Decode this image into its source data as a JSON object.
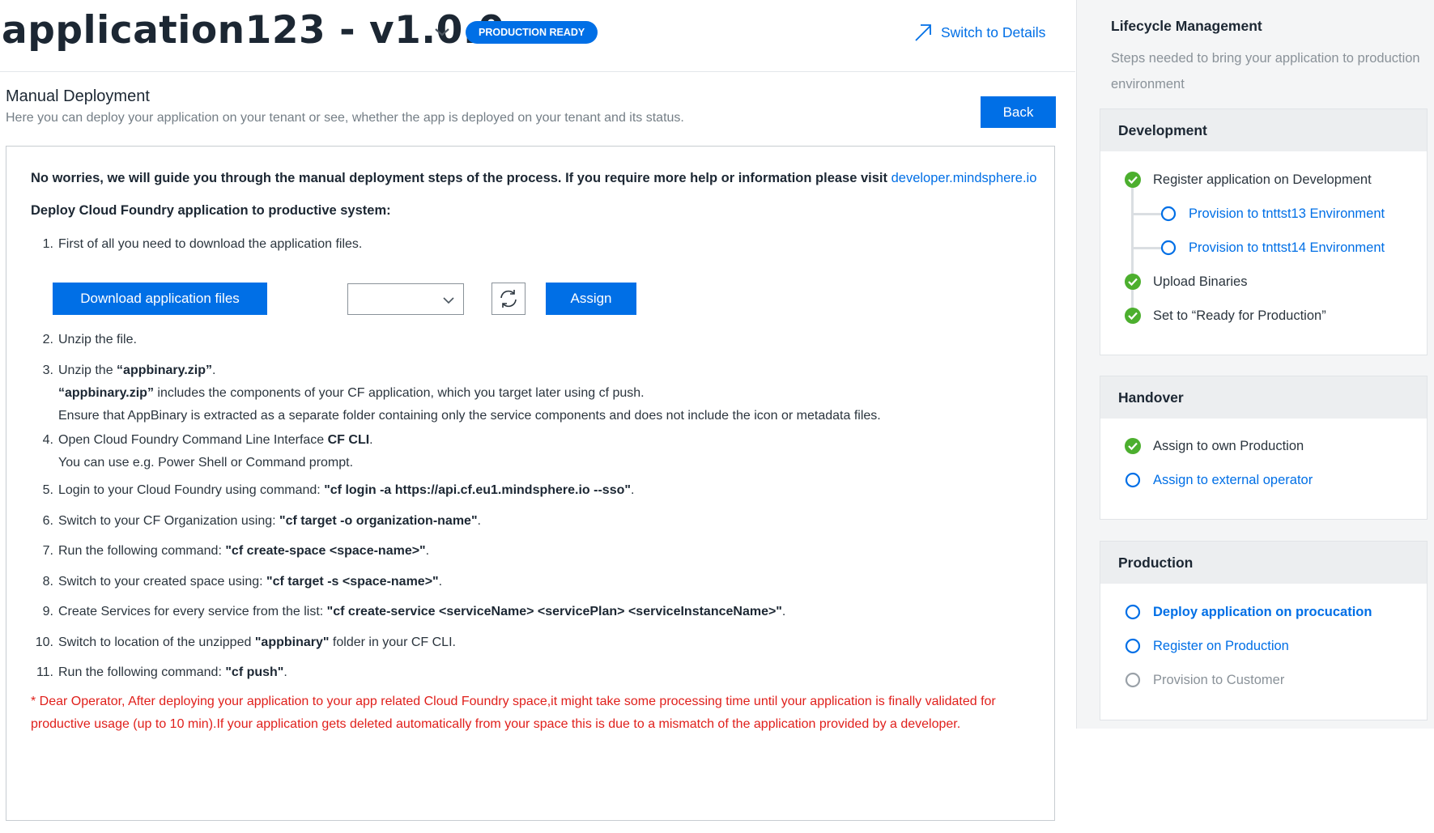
{
  "header": {
    "app_title": "application123 - v1.0.0",
    "status_badge": "PRODUCTION READY",
    "switch_label": "Switch to Details"
  },
  "section": {
    "title": "Manual Deployment",
    "subtitle": "Here you can deploy your application on your tenant or see, whether the app is deployed on your tenant and its status.",
    "back_label": "Back"
  },
  "guide": {
    "intro_text": "No worries, we will guide you through the manual deployment steps of the process. If you require more help or information please visit ",
    "intro_link": "developer.mindsphere.io",
    "deploy_heading": "Deploy Cloud Foundry application to productive system:",
    "download_label": "Download application files",
    "select_value": "",
    "assign_label": "Assign",
    "steps": [
      {
        "num": "1.",
        "a": "First of all you need to download the application files."
      },
      {
        "num": "2.",
        "a": "Unzip the file."
      },
      {
        "num": "3.",
        "a": "Unzip the ",
        "b": "“appbinary.zip”",
        "c": ".",
        "l2b": "“appbinary.zip”",
        "l2": " includes the components of your CF application, which you target later using cf push.",
        "l3": "Ensure that AppBinary is extracted as a separate folder containing only the service components and does not include the icon or metadata files."
      },
      {
        "num": "4.",
        "a": "Open Cloud Foundry Command Line Interface ",
        "b": "CF CLI",
        "c": ".",
        "l2": "You can use e.g. Power Shell or Command prompt."
      },
      {
        "num": "5.",
        "a": "Login to your Cloud Foundry using command: ",
        "b": "\"cf login -a https://api.cf.eu1.mindsphere.io --sso\"",
        "c": "."
      },
      {
        "num": "6.",
        "a": "Switch to your CF Organization using: ",
        "b": "\"cf target -o organization-name\"",
        "c": "."
      },
      {
        "num": "7.",
        "a": "Run the following command: ",
        "b": "\"cf create-space <space-name>\"",
        "c": "."
      },
      {
        "num": "8.",
        "a": "Switch to your created space using: ",
        "b": "\"cf target -s <space-name>\"",
        "c": "."
      },
      {
        "num": "9.",
        "a": "Create Services for every service from the list: ",
        "b": "\"cf create-service <serviceName> <servicePlan> <serviceInstanceName>\"",
        "c": "."
      },
      {
        "num": "10.",
        "a": "Switch to location of the unzipped ",
        "b": "\"appbinary\"",
        "c": " folder in your CF CLI."
      },
      {
        "num": "11.",
        "a": "Run the following command: ",
        "b": "\"cf push\"",
        "c": "."
      }
    ],
    "note": "* Dear Operator, After deploying your application to your app related Cloud Foundry space,it might take some processing time until your application is finally validated for productive usage (up to 10 min).If your application gets deleted automatically from your space this is due to a mismatch of the application provided by a developer."
  },
  "lifecycle": {
    "title": "Lifecycle Management",
    "subtitle": "Steps needed to bring your application to production environment",
    "development": {
      "title": "Development",
      "items": [
        "Register application on Development",
        "Provision to tnttst13 Environment",
        "Provision to tnttst14 Environment",
        "Upload Binaries",
        "Set to “Ready for Production”"
      ]
    },
    "handover": {
      "title": "Handover",
      "items": [
        "Assign to own Production",
        "Assign to external operator"
      ]
    },
    "production": {
      "title": "Production",
      "items": [
        "Deploy application on procucation",
        "Register on Production",
        "Provision to Customer"
      ]
    }
  },
  "colors": {
    "accent": "#006fe6",
    "success": "#4caf2e",
    "warning_text": "#e0201c"
  },
  "icons": [
    "chevron-down-icon",
    "arrow-up-right-icon",
    "refresh-icon",
    "check-circle-icon",
    "open-circle-icon"
  ]
}
